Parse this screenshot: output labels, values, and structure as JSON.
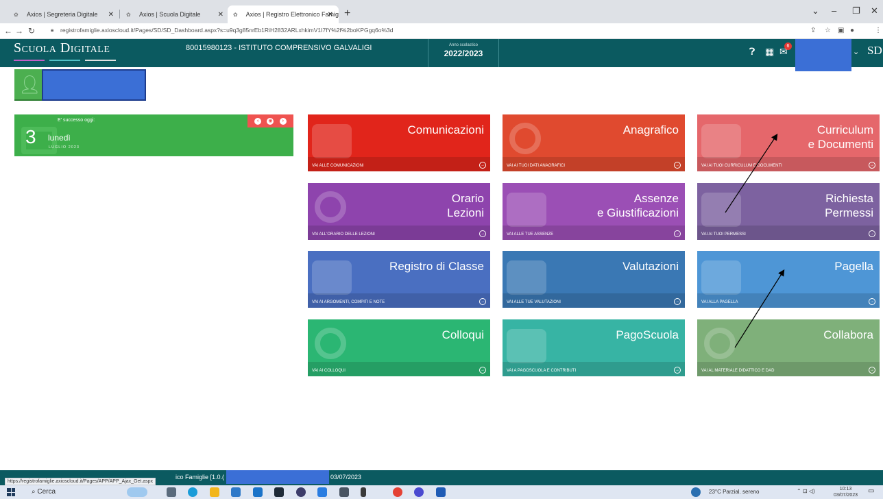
{
  "browser": {
    "tabs": [
      {
        "label": "Axios | Segreteria Digitale",
        "active": false
      },
      {
        "label": "Axios | Scuola Digitale",
        "active": false
      },
      {
        "label": "Axios | Registro Elettronico Famig",
        "active": true
      }
    ],
    "url": "registrofamiglie.axioscloud.it/Pages/SD/SD_Dashboard.aspx?s=u9q3g85nrEb1RiH2832ARLxhkimV1I7fY%2f%2boKPGgq6o%3d"
  },
  "header": {
    "brand": "Scuola Digitale",
    "school": "80015980123 - ISTITUTO COMPRENSIVO GALVALIGI",
    "year_label": "Anno scolastico",
    "year_value": "2022/2023",
    "notification_count": "6",
    "logo": "SD",
    "colors": {
      "header_bg": "#0b5a60",
      "redacted": "#3b6fd6"
    }
  },
  "today": {
    "label": "E' successo oggi:",
    "day": "3",
    "weekday": "lunedì",
    "month_year": "LUGLIO 2023"
  },
  "tiles": [
    {
      "title": "Comunicazioni",
      "link": "VAI ALLE COMUNICAZIONI",
      "color": "#e1251b",
      "icon": "megaphone-icon"
    },
    {
      "title": "Anagrafico",
      "link": "VAI AI TUOI DATI ANAGRAFICI",
      "color": "#e04a2f",
      "icon": "user-icon"
    },
    {
      "title": "Curriculum\ne Documenti",
      "link": "VAI AI TUOI CURRICULUM E DOCUMENTI",
      "color": "#e5676b",
      "icon": "documents-icon"
    },
    {
      "title": "Orario\nLezioni",
      "link": "VAI ALL'ORARIO DELLE LEZIONI",
      "color": "#8e44ad",
      "icon": "clock-icon"
    },
    {
      "title": "Assenze\ne Giustificazioni",
      "link": "VAI ALLE TUE ASSENZE",
      "color": "#9b4fb5",
      "icon": "absence-icon"
    },
    {
      "title": "Richiesta\nPermessi",
      "link": "VAI AI TUOI PERMESSI",
      "color": "#7d62a0",
      "icon": "exit-icon"
    },
    {
      "title": "Registro di Classe",
      "link": "VAI AI ARGOMENTI, COMPITI E NOTE",
      "color": "#4a6fc1",
      "icon": "register-icon"
    },
    {
      "title": "Valutazioni",
      "link": "VAI ALLE TUE VALUTAZIONI",
      "color": "#3a78b4",
      "icon": "grades-icon"
    },
    {
      "title": "Pagella",
      "link": "VAI ALLA PAGELLA",
      "color": "#4e96d6",
      "icon": "report-card-icon"
    },
    {
      "title": "Colloqui",
      "link": "VAI AI COLLOQUI",
      "color": "#2bb673",
      "icon": "chat-icon"
    },
    {
      "title": "PagoScuola",
      "link": "VAI A PAGOSCUOLA E CONTRIBUTI",
      "color": "#37b4a4",
      "icon": "payment-icon"
    },
    {
      "title": "Collabora",
      "link": "VAI AL MATERIALE DIDATTICO E DAD",
      "color": "#7fb07a",
      "icon": "collaborate-icon"
    }
  ],
  "footer": {
    "app_version": "ico Famiglie [1.0.(",
    "date": "03/07/2023",
    "url_tooltip": "https://registrofamiglie.axioscloud.it/Pages/APP/APP_Ajax_Get.aspx"
  },
  "taskbar": {
    "search": "Cerca",
    "weather": "23°C  Parzial. sereno",
    "time": "10:13",
    "date": "03/07/2023"
  }
}
